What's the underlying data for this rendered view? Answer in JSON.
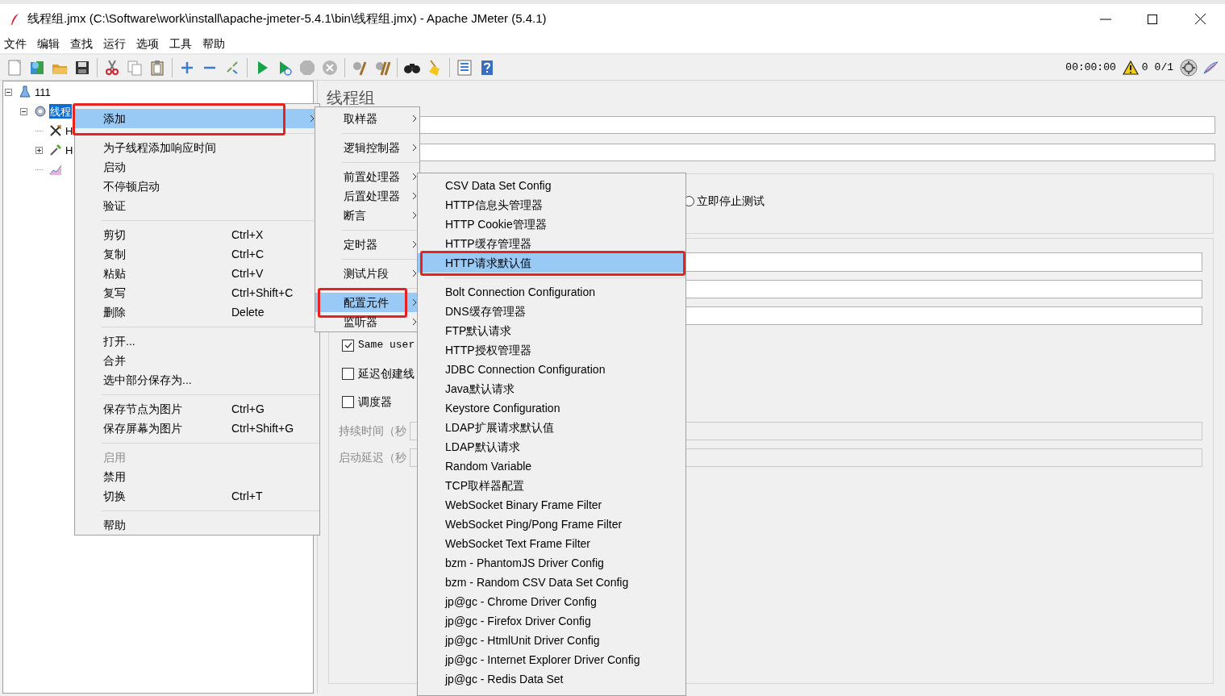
{
  "window": {
    "title": "线程组.jmx (C:\\Software\\work\\install\\apache-jmeter-5.4.1\\bin\\线程组.jmx) - Apache JMeter (5.4.1)"
  },
  "menu_bar": [
    "文件",
    "编辑",
    "查找",
    "运行",
    "选项",
    "工具",
    "帮助"
  ],
  "toolbar": {
    "timer": "00:00:00",
    "warnings": "0",
    "threads": "0/1"
  },
  "tree": [
    {
      "label": "111",
      "kind": "test-plan",
      "selected": false,
      "expanded": true,
      "children": [
        {
          "label": "线程",
          "kind": "thread-group",
          "selected": true,
          "expanded": true,
          "children": [
            {
              "label": "H",
              "kind": "config",
              "selected": false
            },
            {
              "label": "H",
              "kind": "sampler",
              "selected": false,
              "expanded": false
            },
            {
              "kind": "listener",
              "selected": false
            }
          ]
        }
      ]
    }
  ],
  "panel": {
    "title": "线程组",
    "radio": {
      "label": "立即停止测试",
      "selected": false
    },
    "checkboxes": [
      {
        "label": "Same user",
        "checked": true,
        "kind": "mono"
      },
      {
        "label": "延迟创建线",
        "checked": false,
        "kind": "plain"
      },
      {
        "label": "调度器",
        "checked": false,
        "kind": "plain"
      }
    ],
    "schedule_rows": [
      {
        "label": "持续时间（秒",
        "disabled": true
      },
      {
        "label": "启动延迟（秒",
        "disabled": true
      }
    ]
  },
  "context_menu": {
    "annotated": true,
    "items": [
      {
        "kind": "item",
        "label": "添加",
        "submenu": true,
        "selected": true,
        "disabled": false
      },
      {
        "kind": "separator"
      },
      {
        "kind": "item",
        "label": "为子线程添加响应时间",
        "selected": false,
        "disabled": false
      },
      {
        "kind": "item",
        "label": "启动",
        "selected": false,
        "disabled": false
      },
      {
        "kind": "item",
        "label": "不停顿启动",
        "selected": false,
        "disabled": false
      },
      {
        "kind": "item",
        "label": "验证",
        "selected": false,
        "disabled": false
      },
      {
        "kind": "separator"
      },
      {
        "kind": "item",
        "label": "剪切",
        "shortcut": "Ctrl+X",
        "selected": false,
        "disabled": false
      },
      {
        "kind": "item",
        "label": "复制",
        "shortcut": "Ctrl+C",
        "selected": false,
        "disabled": false
      },
      {
        "kind": "item",
        "label": "粘贴",
        "shortcut": "Ctrl+V",
        "selected": false,
        "disabled": false
      },
      {
        "kind": "item",
        "label": "复写",
        "shortcut": "Ctrl+Shift+C",
        "selected": false,
        "disabled": false
      },
      {
        "kind": "item",
        "label": "删除",
        "shortcut": "Delete",
        "selected": false,
        "disabled": false
      },
      {
        "kind": "separator"
      },
      {
        "kind": "item",
        "label": "打开...",
        "selected": false,
        "disabled": false
      },
      {
        "kind": "item",
        "label": "合并",
        "selected": false,
        "disabled": false
      },
      {
        "kind": "item",
        "label": "选中部分保存为...",
        "selected": false,
        "disabled": false
      },
      {
        "kind": "separator"
      },
      {
        "kind": "item",
        "label": "保存节点为图片",
        "shortcut": "Ctrl+G",
        "selected": false,
        "disabled": false
      },
      {
        "kind": "item",
        "label": "保存屏幕为图片",
        "shortcut": "Ctrl+Shift+G",
        "selected": false,
        "disabled": false
      },
      {
        "kind": "separator"
      },
      {
        "kind": "item",
        "label": "启用",
        "selected": false,
        "disabled": true
      },
      {
        "kind": "item",
        "label": "禁用",
        "selected": false,
        "disabled": false
      },
      {
        "kind": "item",
        "label": "切换",
        "shortcut": "Ctrl+T",
        "selected": false,
        "disabled": false
      },
      {
        "kind": "separator"
      },
      {
        "kind": "item",
        "label": "帮助",
        "selected": false,
        "disabled": false
      }
    ]
  },
  "add_submenu": {
    "annotated": true,
    "items": [
      {
        "kind": "item",
        "label": "取样器",
        "submenu": true,
        "selected": false
      },
      {
        "kind": "separator"
      },
      {
        "kind": "item",
        "label": "逻辑控制器",
        "submenu": true,
        "selected": false
      },
      {
        "kind": "separator"
      },
      {
        "kind": "item",
        "label": "前置处理器",
        "submenu": true,
        "selected": false
      },
      {
        "kind": "item",
        "label": "后置处理器",
        "submenu": true,
        "selected": false
      },
      {
        "kind": "item",
        "label": "断言",
        "submenu": true,
        "selected": false
      },
      {
        "kind": "separator"
      },
      {
        "kind": "item",
        "label": "定时器",
        "submenu": true,
        "selected": false
      },
      {
        "kind": "separator"
      },
      {
        "kind": "item",
        "label": "测试片段",
        "submenu": true,
        "selected": false
      },
      {
        "kind": "separator"
      },
      {
        "kind": "item",
        "label": "配置元件",
        "submenu": true,
        "selected": true
      },
      {
        "kind": "item",
        "label": "监听器",
        "submenu": true,
        "selected": false
      }
    ]
  },
  "config_submenu": {
    "annotated": true,
    "items": [
      {
        "kind": "item",
        "label": "CSV Data Set Config",
        "selected": false
      },
      {
        "kind": "item",
        "label": "HTTP信息头管理器",
        "selected": false
      },
      {
        "kind": "item",
        "label": "HTTP Cookie管理器",
        "selected": false
      },
      {
        "kind": "item",
        "label": "HTTP缓存管理器",
        "selected": false
      },
      {
        "kind": "item",
        "label": "HTTP请求默认值",
        "selected": true
      },
      {
        "kind": "separator"
      },
      {
        "kind": "item",
        "label": "Bolt Connection Configuration",
        "selected": false
      },
      {
        "kind": "item",
        "label": "DNS缓存管理器",
        "selected": false
      },
      {
        "kind": "item",
        "label": "FTP默认请求",
        "selected": false
      },
      {
        "kind": "item",
        "label": "HTTP授权管理器",
        "selected": false
      },
      {
        "kind": "item",
        "label": "JDBC Connection Configuration",
        "selected": false
      },
      {
        "kind": "item",
        "label": "Java默认请求",
        "selected": false
      },
      {
        "kind": "item",
        "label": "Keystore Configuration",
        "selected": false
      },
      {
        "kind": "item",
        "label": "LDAP扩展请求默认值",
        "selected": false
      },
      {
        "kind": "item",
        "label": "LDAP默认请求",
        "selected": false
      },
      {
        "kind": "item",
        "label": "Random Variable",
        "selected": false
      },
      {
        "kind": "item",
        "label": "TCP取样器配置",
        "selected": false
      },
      {
        "kind": "item",
        "label": "WebSocket Binary Frame Filter",
        "selected": false
      },
      {
        "kind": "item",
        "label": "WebSocket Ping/Pong Frame Filter",
        "selected": false
      },
      {
        "kind": "item",
        "label": "WebSocket Text Frame Filter",
        "selected": false
      },
      {
        "kind": "item",
        "label": "bzm - PhantomJS Driver Config",
        "selected": false
      },
      {
        "kind": "item",
        "label": "bzm - Random CSV Data Set Config",
        "selected": false
      },
      {
        "kind": "item",
        "label": "jp@gc - Chrome Driver Config",
        "selected": false
      },
      {
        "kind": "item",
        "label": "jp@gc - Firefox Driver Config",
        "selected": false
      },
      {
        "kind": "item",
        "label": "jp@gc - HtmlUnit Driver Config",
        "selected": false
      },
      {
        "kind": "item",
        "label": "jp@gc - Internet Explorer Driver Config",
        "selected": false
      },
      {
        "kind": "item",
        "label": "jp@gc - Redis Data Set",
        "selected": false
      }
    ]
  }
}
